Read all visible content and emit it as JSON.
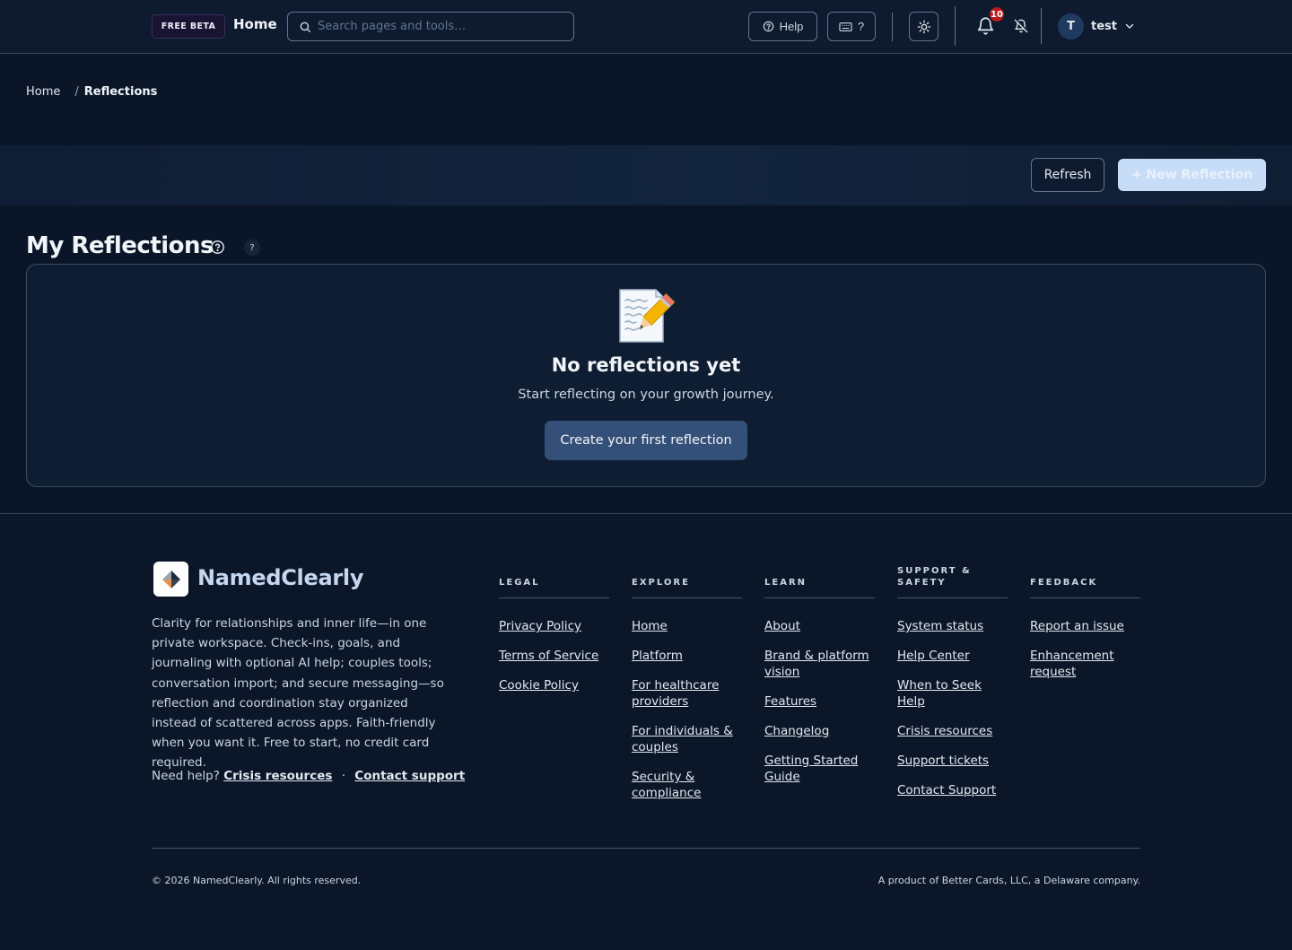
{
  "header": {
    "beta_label": "FREE BETA",
    "title": "Home",
    "search_placeholder": "Search pages and tools…",
    "help_label": "Help",
    "shortcuts_label": "?",
    "notification_count": "10",
    "user_initial": "T",
    "user_name": "test"
  },
  "breadcrumb": {
    "home": "Home",
    "separator": "/",
    "current": "Reflections"
  },
  "actions": {
    "refresh_label": "Refresh",
    "new_label": "+ New Reflection"
  },
  "main": {
    "title": "My Reflections",
    "help_small": "?",
    "empty_icon": "memo-icon",
    "empty_title": "No reflections yet",
    "empty_subtitle": "Start reflecting on your growth journey.",
    "create_label": "Create your first reflection"
  },
  "footer": {
    "brand": "NamedClearly",
    "tagline": "Clarity for relationships and inner life—in one private workspace. Check-ins, goals, and journaling with optional AI help; couples tools; conversation import; and secure messaging—so reflection and coordination stay organized instead of scattered across apps. Faith-friendly when you want it. Free to start, no credit card required.",
    "need_help": "Need help?",
    "crisis_link": "Crisis resources",
    "dot": "·",
    "contact_link": "Contact support",
    "columns": [
      {
        "heading": "LEGAL",
        "links": [
          "Privacy Policy",
          "Terms of Service",
          "Cookie Policy"
        ]
      },
      {
        "heading": "EXPLORE",
        "links": [
          "Home",
          "Platform",
          "For healthcare providers",
          "For individuals & couples",
          "Security & compliance"
        ]
      },
      {
        "heading": "LEARN",
        "links": [
          "About",
          "Brand & platform vision",
          "Features",
          "Changelog",
          "Getting Started Guide"
        ]
      },
      {
        "heading": "SUPPORT & SAFETY",
        "links": [
          "System status",
          "Help Center",
          "When to Seek Help",
          "Crisis resources",
          "Support tickets",
          "Contact Support"
        ]
      },
      {
        "heading": "FEEDBACK",
        "links": [
          "Report an issue",
          "Enhancement request"
        ]
      }
    ],
    "copyright": "© 2026 NamedClearly. All rights reserved.",
    "product": "A product of Better Cards, LLC, a Delaware company."
  },
  "colors": {
    "background": "#0a1628",
    "accent": "#345078",
    "primary_button": "#c7dcf6",
    "badge": "#b91c1c",
    "brand_text": "#c5d6ee"
  }
}
